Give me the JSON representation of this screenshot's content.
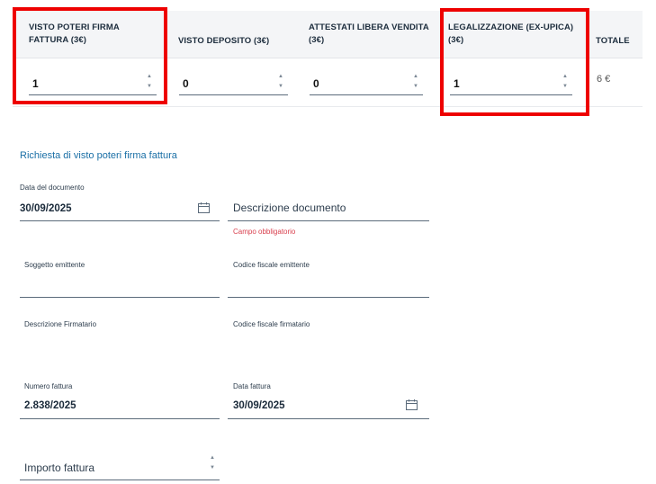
{
  "quantity_table": {
    "columns": [
      {
        "header_line1": "VISTO POTERI FIRMA",
        "header_line2": "FATTURA (3€)",
        "value": "1"
      },
      {
        "header_line1": "VISTO DEPOSITO (3€)",
        "header_line2": "",
        "value": "0"
      },
      {
        "header_line1": "ATTESTATI LIBERA VENDITA",
        "header_line2": "(3€)",
        "value": "0"
      },
      {
        "header_line1": "LEGALIZZAZIONE (EX-UPICA)",
        "header_line2": "(3€)",
        "value": "1"
      }
    ],
    "total_header": "TOTALE",
    "total_value": "6 €",
    "stepper_up": "▲",
    "stepper_down": "▼"
  },
  "highlight_color": "#ee0000",
  "form": {
    "section_title": "Richiesta di visto poteri firma fattura",
    "data_documento": {
      "label": "Data del documento",
      "value": "30/09/2025"
    },
    "descrizione_documento": {
      "placeholder": "Descrizione documento",
      "error": "Campo obbligatorio"
    },
    "soggetto_emittente": {
      "label": "Soggetto emittente",
      "value": ""
    },
    "codice_fiscale_emittente": {
      "label": "Codice fiscale emittente",
      "value": ""
    },
    "descrizione_firmatario": {
      "label": "Descrizione Firmatario",
      "value": ""
    },
    "codice_fiscale_firmatario": {
      "label": "Codice fiscale firmatario",
      "value": ""
    },
    "numero_fattura": {
      "label": "Numero fattura",
      "value": "2.838/2025"
    },
    "data_fattura": {
      "label": "Data fattura",
      "value": "30/09/2025"
    },
    "importo_fattura": {
      "placeholder": "Importo fattura",
      "value": ""
    }
  },
  "colors": {
    "accent": "#1a6fa6",
    "error": "#d9414f",
    "header_bg": "#f4f5f7"
  }
}
